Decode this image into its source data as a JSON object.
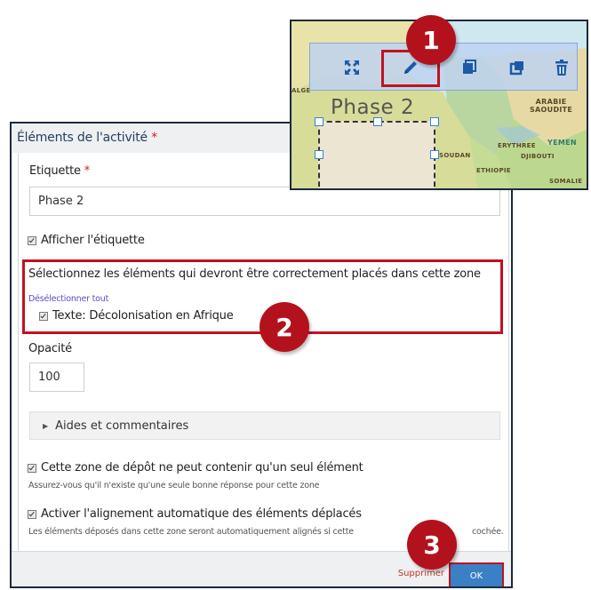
{
  "dialog": {
    "title": "Éléments de l'activité",
    "required_mark": "*",
    "label_field": {
      "label": "Etiquette",
      "required_mark": "*",
      "value": "Phase 2"
    },
    "show_label": {
      "label": "Afficher l'étiquette",
      "checked": true
    },
    "select_section": {
      "heading": "Sélectionnez les éléments qui devront être correctement placés dans cette zone",
      "deselect_all": "Désélectionner tout",
      "items": [
        {
          "label": "Texte: Décolonisation en Afrique",
          "checked": true
        }
      ]
    },
    "opacity": {
      "label": "Opacité",
      "value": "100"
    },
    "accordion": {
      "label": "Aides et commentaires"
    },
    "single_element": {
      "label": "Cette zone de dépôt ne peut contenir qu'un seul élément",
      "hint": "Assurez-vous qu'il n'existe qu'une seule bonne réponse pour cette zone",
      "checked": true
    },
    "auto_align": {
      "label": "Activer l'alignement automatique des éléments déplacés",
      "hint_start": "Les éléments déposés dans cette zone seront automatiquement alignés si cette",
      "hint_end": "cochée.",
      "checked": true
    },
    "footer": {
      "delete_label": "Supprimer",
      "ok_label": "OK"
    }
  },
  "map_inset": {
    "zone_label": "Phase 2",
    "map_labels": [
      "ARABIE",
      "SAOUDITE",
      "YEMEN",
      "ERYTHREE",
      "DJIBOUTI",
      "ETHIOPIE",
      "SOMALIE",
      "SOUDAN",
      "ALGE"
    ],
    "toolbar_icons": [
      "expand-icon",
      "pencil-icon",
      "copy-icon",
      "duplicate-icon",
      "trash-icon"
    ]
  },
  "badges": [
    "1",
    "2",
    "3"
  ],
  "colors": {
    "highlight": "#c1121f",
    "badge": "#b3121d",
    "accent_blue": "#3b7fc4",
    "required": "#d01c1c",
    "link": "#5b4bcc"
  }
}
